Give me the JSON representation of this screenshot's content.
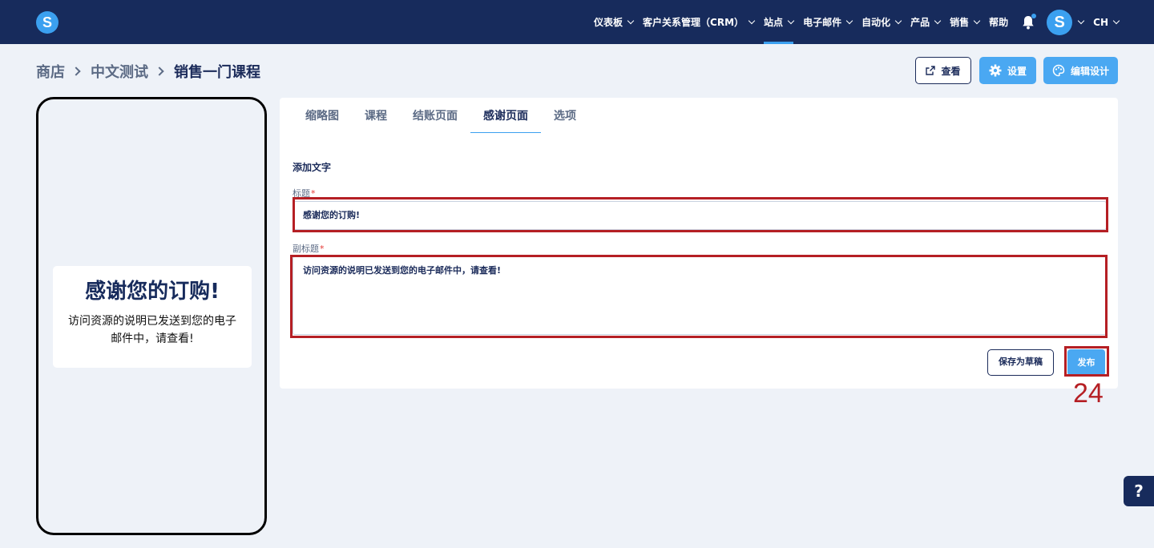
{
  "app": {
    "logo_letter": "S"
  },
  "nav": {
    "items": [
      {
        "label": "仪表板",
        "has_menu": true
      },
      {
        "label": "客户关系管理（CRM）",
        "has_menu": true
      },
      {
        "label": "站点",
        "has_menu": true,
        "active": true
      },
      {
        "label": "电子邮件",
        "has_menu": true
      },
      {
        "label": "自动化",
        "has_menu": true
      },
      {
        "label": "产品",
        "has_menu": true
      },
      {
        "label": "销售",
        "has_menu": true
      },
      {
        "label": "帮助",
        "has_menu": false
      }
    ],
    "avatar_letter": "S",
    "language": "CH"
  },
  "breadcrumb": [
    "商店",
    "中文测试",
    "销售一门课程"
  ],
  "actions": {
    "view": "查看",
    "settings": "设置",
    "edit_design": "编辑设计"
  },
  "preview": {
    "title": "感谢您的订购!",
    "subtitle": "访问资源的说明已发送到您的电子邮件中，请查看!"
  },
  "tabs": [
    {
      "label": "缩略图"
    },
    {
      "label": "课程"
    },
    {
      "label": "结账页面"
    },
    {
      "label": "感谢页面",
      "active": true
    },
    {
      "label": "选项"
    }
  ],
  "form": {
    "section_title": "添加文字",
    "title_label": "标题",
    "title_value": "感谢您的订购!",
    "subtitle_label": "副标题",
    "subtitle_value": "访问资源的说明已发送到您的电子邮件中，请查看!",
    "required_mark": "*",
    "save_draft": "保存为草稿",
    "publish": "发布"
  },
  "annotation": {
    "step_number": "24",
    "color": "#b51f24"
  },
  "help": {
    "label": "?"
  },
  "colors": {
    "navy": "#172b5c",
    "accent": "#3ba0f0",
    "button_blue": "#4aa8f2",
    "background": "#eef2f8"
  }
}
